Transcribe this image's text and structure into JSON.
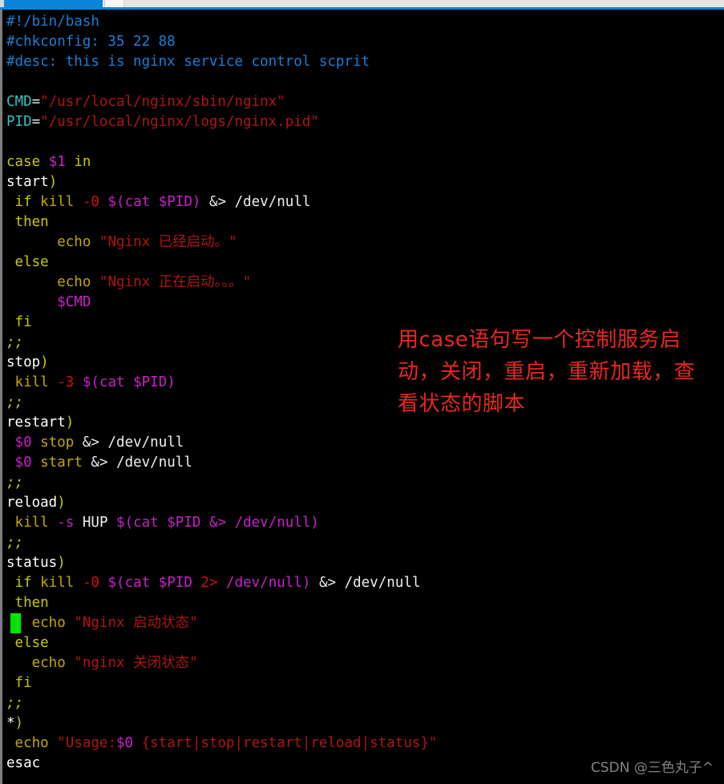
{
  "window": {
    "tabs": [
      {
        "name": "active-tab",
        "state": "active",
        "color": "#0984d8"
      },
      {
        "name": "inactive-tab",
        "state": "inactive",
        "color": "#f7f7f7"
      }
    ],
    "accent_color": "#0b84d9",
    "background_color": "#000000"
  },
  "editor": {
    "language": "bash",
    "cursor": {
      "line": 30,
      "column": 1,
      "color": "#00e500"
    },
    "colors": {
      "comment": "#1a7fd4",
      "variable": "#2ec4c4",
      "string": "#b01515",
      "keyword": "#c8c800",
      "command": "#c0a800",
      "substitution": "#c820c8",
      "flag": "#cc1111",
      "plain": "#ffffff"
    },
    "lines": [
      "#!/bin/bash",
      "#chkconfig: 35 22 88",
      "#desc: this is nginx service control scprit",
      "",
      "CMD=\"/usr/local/nginx/sbin/nginx\"",
      "PID=\"/usr/local/nginx/logs/nginx.pid\"",
      "",
      "case $1 in",
      "start)",
      " if kill -0 $(cat $PID) &> /dev/null",
      " then",
      "      echo \"Nginx 已经启动。\"",
      " else",
      "      echo \"Nginx 正在启动。。。\"",
      "      $CMD",
      " fi",
      ";;",
      "stop)",
      " kill -3 $(cat $PID)",
      ";;",
      "restart)",
      " $0 stop &> /dev/null",
      " $0 start &> /dev/null",
      ";;",
      "reload)",
      " kill -s HUP $(cat $PID &> /dev/null)",
      ";;",
      "status)",
      " if kill -0 $(cat $PID 2> /dev/null) &> /dev/null",
      " then",
      "   echo \"Nginx 启动状态\"",
      " else",
      "   echo \"nginx 关闭状态\"",
      " fi",
      ";;",
      "*)",
      " echo \"Usage:$0 {start|stop|restart|reload|status}\"",
      "esac"
    ],
    "tokens": {
      "shebang": "#!/bin/bash",
      "chkconfig": "#chkconfig: 35 22 88",
      "desc": "#desc: this is nginx service control scprit",
      "cmd_name": "CMD",
      "cmd_value": "\"/usr/local/nginx/sbin/nginx\"",
      "pid_name": "PID",
      "pid_value": "\"/usr/local/nginx/logs/nginx.pid\"",
      "case_kw": "case",
      "case_arg": "$1",
      "in_kw": "in",
      "label_start": "start",
      "label_stop": "stop",
      "label_restart": "restart",
      "label_reload": "reload",
      "label_status": "status",
      "label_default": "*",
      "paren": ")",
      "if_kw": "if",
      "then_kw": "then",
      "else_kw": "else",
      "fi_kw": "fi",
      "esac_kw": "esac",
      "semis": ";;",
      "kill_cmd": "kill",
      "echo_cmd": "echo",
      "flag_0": "-0",
      "flag_3": "-3",
      "flag_s": "-s",
      "hup_sig": "HUP",
      "subst_cat_pid": "$(cat $PID)",
      "subst_cat_pid_open": "$(cat $PID",
      "subst_close": ")",
      "redirect_amp": "&>",
      "redirect_2": "2>",
      "devnull": "/dev/null",
      "devnull_m": "/dev/null)",
      "var_cmd": "$CMD",
      "var_zero": "$0",
      "str_started": "\"Nginx 已经启动。\"",
      "str_starting": "\"Nginx 正在启动。。。\"",
      "str_status_on": "\"Nginx 启动状态\"",
      "str_status_off": "\"nginx 关闭状态\"",
      "str_usage": "\"Usage:",
      "str_usage_tail": " {start|stop|restart|reload|status}\""
    }
  },
  "annotation": {
    "text": "用case语句写一个控制服务启动，关闭，重启，重新加载，查看状态的脚本",
    "color": "#e8281e"
  },
  "watermark": {
    "text": "CSDN @三色丸子^"
  }
}
